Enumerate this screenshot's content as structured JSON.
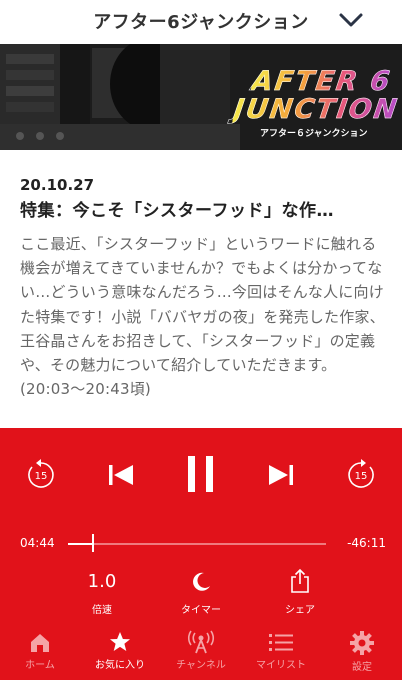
{
  "header": {
    "title": "アフター6ジャンクション"
  },
  "banner": {
    "logo_line1": "AFTER 6",
    "logo_line2": "JUNCTION",
    "logo_sub": "アフター６ジャンクション"
  },
  "episode": {
    "date": "20.10.27",
    "title": "特集：今こそ「シスターフッド」な作…",
    "description": "ここ最近、「シスターフッド」というワードに触れる機会が増えてきていませんか？でもよくは分かってない…どういう意味なんだろう…今回はそんな人に向けた特集です！小説「ババヤガの夜」を発売した作家、王谷晶さんをお招きして、「シスターフッド」の定義や、その魅力について紹介していただきます。(20:03〜20:43頃)"
  },
  "player": {
    "skip_back_seconds": "15",
    "skip_forward_seconds": "15",
    "elapsed": "04:44",
    "remaining": "-46:11",
    "progress_fraction": 0.093,
    "colors": {
      "background": "#e1121a",
      "track": "#f07a7e"
    }
  },
  "options": {
    "speed_value": "1.0",
    "speed_label": "倍速",
    "timer_label": "タイマー",
    "share_label": "シェア"
  },
  "tabs": [
    {
      "label": "ホーム",
      "icon": "home-icon"
    },
    {
      "label": "お気に入り",
      "icon": "star-icon",
      "active": true
    },
    {
      "label": "チャンネル",
      "icon": "antenna-icon"
    },
    {
      "label": "マイリスト",
      "icon": "list-icon"
    },
    {
      "label": "設定",
      "icon": "gear-icon"
    }
  ]
}
